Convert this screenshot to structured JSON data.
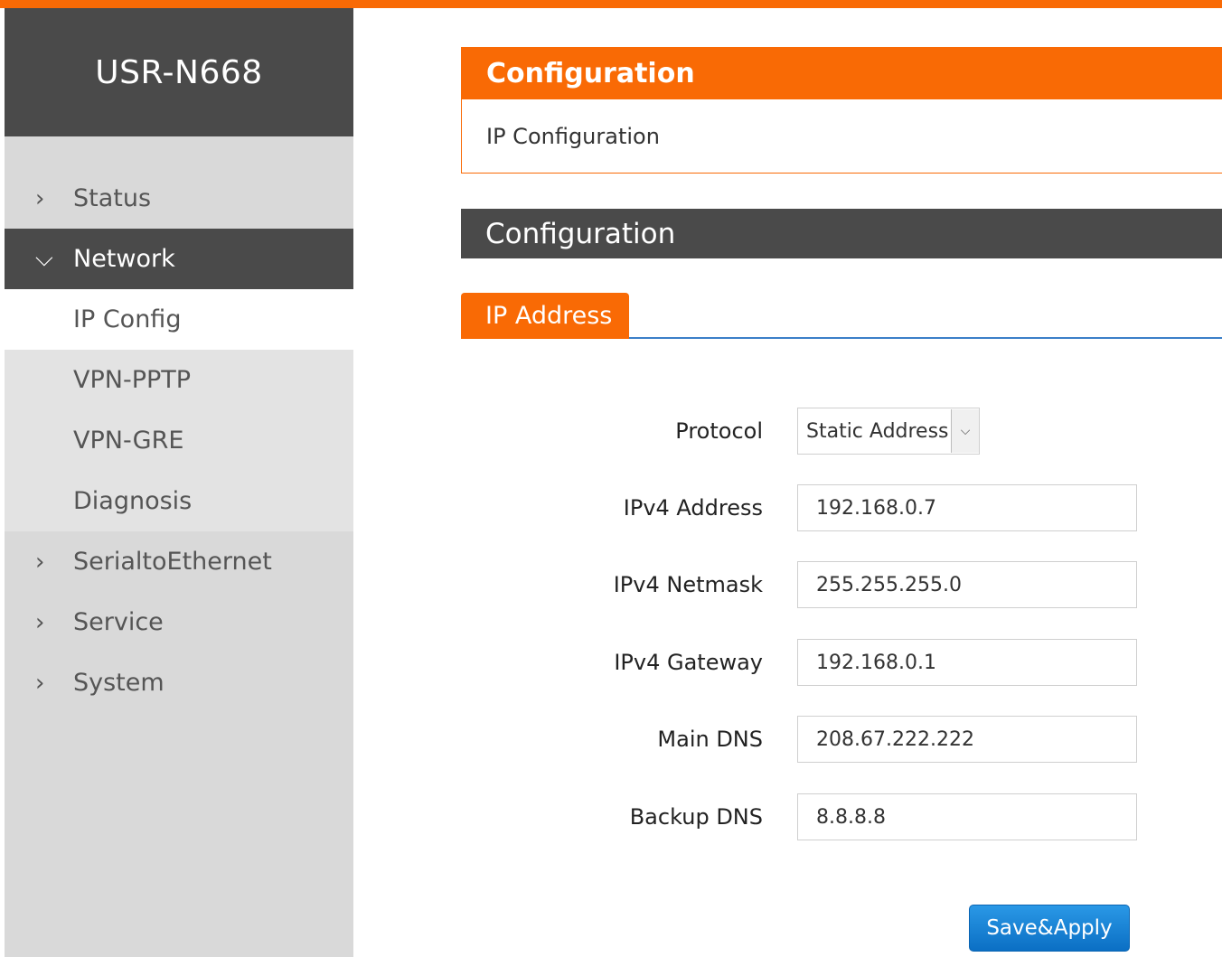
{
  "app": {
    "title": "USR-N668"
  },
  "sidebar": {
    "items": [
      {
        "label": "Status",
        "icon": "chevron-right-icon"
      },
      {
        "label": "Network",
        "icon": "chevron-down-icon"
      },
      {
        "label": "SerialtoEthernet",
        "icon": "chevron-right-icon"
      },
      {
        "label": "Service",
        "icon": "chevron-right-icon"
      },
      {
        "label": "System",
        "icon": "chevron-right-icon"
      }
    ],
    "network_sub": [
      "IP Config",
      "VPN-PPTP",
      "VPN-GRE",
      "Diagnosis"
    ]
  },
  "header": {
    "title": "Configuration",
    "breadcrumb": "IP Configuration"
  },
  "section": {
    "title": "Configuration"
  },
  "tabs": [
    {
      "label": "IP Address"
    }
  ],
  "form": {
    "protocol": {
      "label": "Protocol",
      "value": "Static Address"
    },
    "ipv4_address": {
      "label": "IPv4 Address",
      "value": "192.168.0.7"
    },
    "ipv4_netmask": {
      "label": "IPv4 Netmask",
      "value": "255.255.255.0"
    },
    "ipv4_gateway": {
      "label": "IPv4 Gateway",
      "value": "192.168.0.1"
    },
    "main_dns": {
      "label": "Main DNS",
      "value": "208.67.222.222"
    },
    "backup_dns": {
      "label": "Backup DNS",
      "value": "8.8.8.8"
    }
  },
  "actions": {
    "save_label": "Save&Apply"
  },
  "colors": {
    "accent": "#f96a05",
    "dark": "#4a4a4a",
    "sidebar_bg": "#d9d9d9",
    "button": "#1a84d6",
    "tab_line": "#3b7fc8"
  }
}
